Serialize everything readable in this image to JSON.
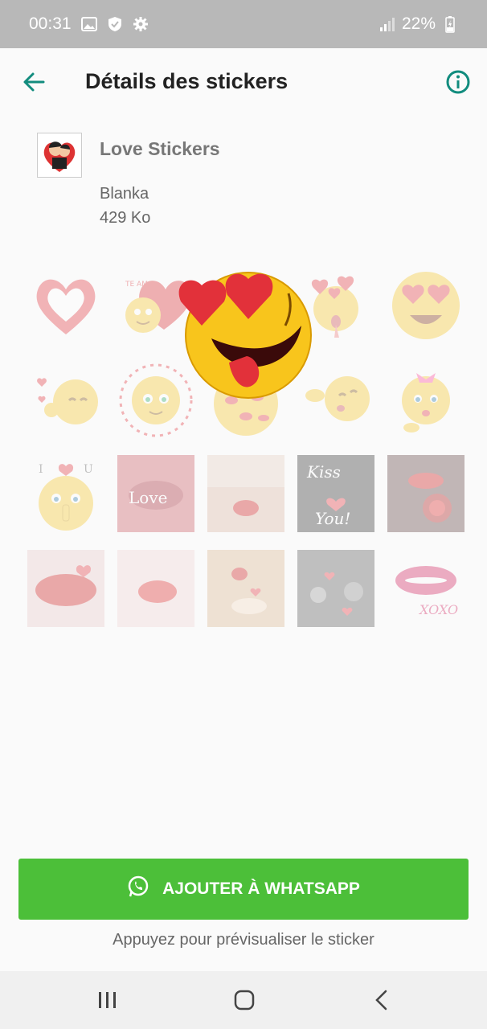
{
  "status_bar": {
    "time": "00:31",
    "battery": "22%",
    "icons": [
      "gallery-icon",
      "shield-icon",
      "gear-icon",
      "signal-icon",
      "battery-charging-icon"
    ]
  },
  "app_bar": {
    "title": "Détails des stickers",
    "back_icon": "back-arrow-icon",
    "info_icon": "info-icon"
  },
  "pack": {
    "name": "Love Stickers",
    "author": "Blanka",
    "size": "429 Ko"
  },
  "stickers": [
    "heart-sticker",
    "te-amo-heart-sticker",
    "heart-eyes-tongue-sticker",
    "hearts-kissy-face-sticker",
    "heart-eyes-face-sticker",
    "blowing-kiss-sticker",
    "blushing-face-sticker",
    "kiss-marks-face-sticker",
    "blowing-kiss-face-sticker",
    "girl-face-sticker",
    "i-love-u-sticker",
    "love-lips-photo-sticker",
    "red-lips-photo-sticker",
    "kiss-you-sticker",
    "lips-rose-photo-sticker",
    "lips-hearts-photo-sticker",
    "lips-photo-sticker",
    "blowing-hearts-photo-sticker",
    "bw-hearts-photo-sticker",
    "xoxo-lips-sticker"
  ],
  "photo_texts": {
    "love": "Love",
    "kiss": "Kiss",
    "you": "You!",
    "xoxo": "XOXO",
    "i_u_left": "I",
    "i_u_right": "U",
    "te_amo": "TE AMO"
  },
  "add_button": {
    "label": "AJOUTER À WHATSAPP",
    "icon": "whatsapp-icon",
    "color": "#4cbf39"
  },
  "hint": "Appuyez pour prévisualiser le sticker",
  "nav_bar": {
    "icons": [
      "recent-apps-icon",
      "home-icon",
      "back-icon"
    ]
  },
  "colors": {
    "accent": "#128c7e",
    "status_bar": "#b8b8b8",
    "button_green": "#4cbf39"
  }
}
